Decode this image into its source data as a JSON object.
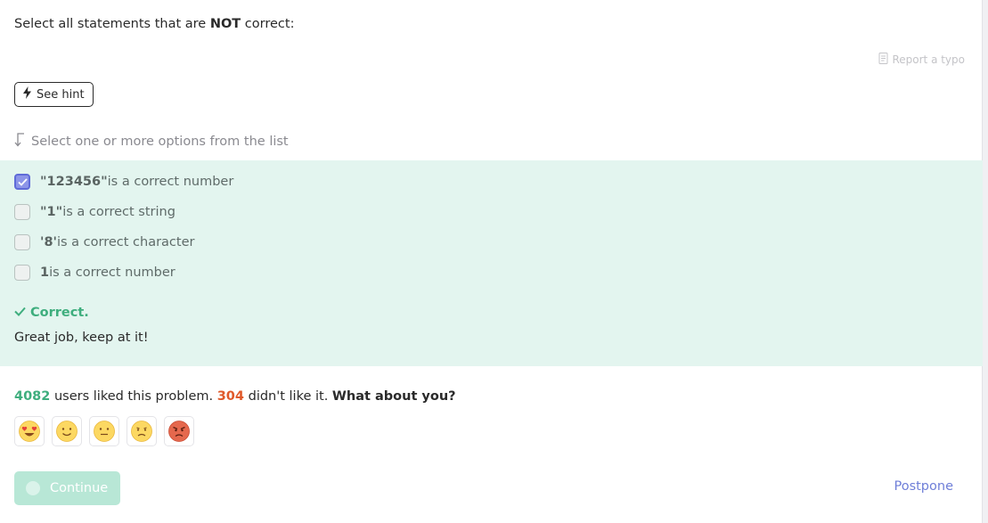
{
  "question": {
    "prefix": "Select all statements that are ",
    "emphasis": "NOT",
    "suffix": " correct:"
  },
  "report_label": "Report a typo",
  "hint_label": "See hint",
  "instruction": "Select one or more options from the list",
  "options": [
    {
      "strong": "\"123456\"",
      "text": " is a correct number",
      "checked": true
    },
    {
      "strong": "\"1\"",
      "text": " is a correct string",
      "checked": false
    },
    {
      "strong": "'8'",
      "text": " is a correct character",
      "checked": false
    },
    {
      "strong": "1",
      "text": " is a correct number",
      "checked": false
    }
  ],
  "feedback": {
    "title": "Correct.",
    "text": "Great job, keep at it!"
  },
  "stats": {
    "liked_count": "4082",
    "liked_text": " users liked this problem. ",
    "disliked_count": "304",
    "disliked_text": " didn't like it. ",
    "ask": "What about you?"
  },
  "reactions": [
    "love-face-icon",
    "smile-face-icon",
    "neutral-face-icon",
    "sad-face-icon",
    "angry-face-icon"
  ],
  "continue_label": "Continue",
  "postpone_label": "Postpone",
  "colors": {
    "accent_green": "#3fae7e",
    "accent_red": "#e0592a",
    "answer_bg": "#e3f5ef",
    "checkbox_checked": "#8c95e8",
    "link_blue": "#6f7fd8",
    "continue_bg": "#b8e7d6"
  }
}
